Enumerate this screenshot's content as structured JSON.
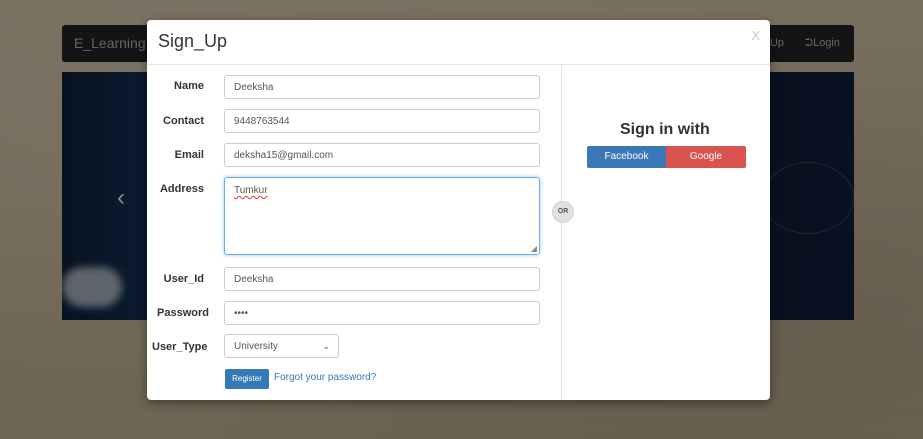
{
  "navbar": {
    "brand": "E_Learning",
    "signup": "Up",
    "login": "Login"
  },
  "modal": {
    "title": "Sign_Up",
    "close": "X",
    "fields": {
      "name": {
        "label": "Name",
        "value": "Deeksha"
      },
      "contact": {
        "label": "Contact",
        "value": "9448763544"
      },
      "email": {
        "label": "Email",
        "value": "deksha15@gmail.com"
      },
      "address": {
        "label": "Address",
        "value": "Tumkur"
      },
      "user_id": {
        "label": "User_Id",
        "value": "Deeksha"
      },
      "password": {
        "label": "Password",
        "value": "••••"
      },
      "user_type": {
        "label": "User_Type",
        "value": "University"
      }
    },
    "register_label": "Register",
    "forgot_label": "Forgot your password?",
    "or_label": "OR",
    "signin_with": "Sign in with",
    "facebook_label": "Facebook",
    "google_label": "Google"
  },
  "colors": {
    "primary": "#337ab7",
    "facebook": "#3b78b7",
    "google": "#d9534f"
  }
}
